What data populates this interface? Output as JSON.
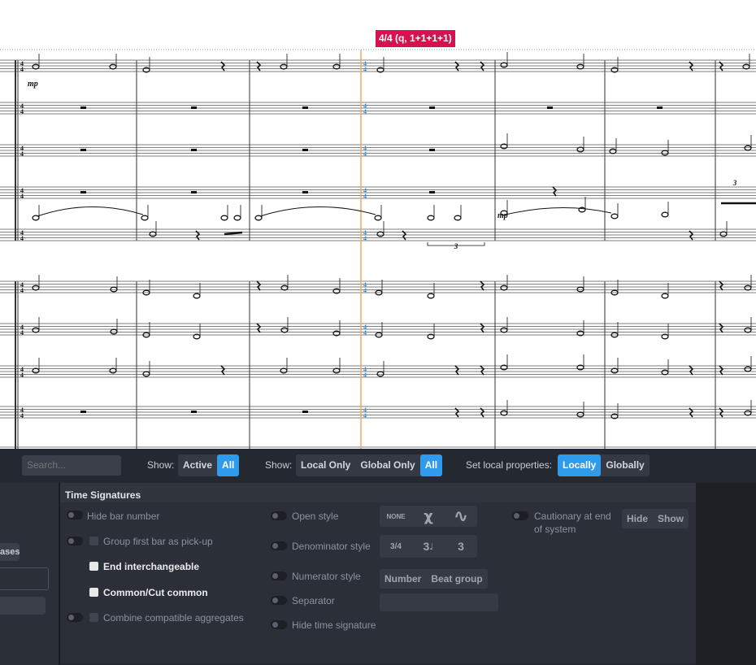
{
  "score": {
    "time_signature_tag": "4/4 (q, 1+1+1+1)",
    "dynamic_mark": "mp",
    "tuplet_number": "3"
  },
  "filter_bar": {
    "search_placeholder": "Search...",
    "show_label_1": "Show:",
    "active_label": "Active",
    "all_label_1": "All",
    "show_label_2": "Show:",
    "local_only_label": "Local Only",
    "global_only_label": "Global Only",
    "all_label_2": "All",
    "set_local_label": "Set local properties:",
    "locally_label": "Locally",
    "globally_label": "Globally"
  },
  "left_fragment": {
    "button_label": "ases"
  },
  "time_signatures": {
    "title": "Time Signatures",
    "col1": {
      "hide_bar_number": "Hide bar number",
      "group_first_bar": "Group first bar as pick-up",
      "end_interchangeable": "End interchangeable",
      "common_cut": "Common/Cut common",
      "combine_aggregates": "Combine compatible aggregates"
    },
    "col2": {
      "open_style": "Open style",
      "denominator_style": "Denominator style",
      "numerator_style": "Numerator style",
      "separator": "Separator",
      "hide_time_signature": "Hide time signature"
    },
    "open_style_options": {
      "none": "NONE",
      "x": "χ",
      "wave": "∿"
    },
    "denominator_options": {
      "fraction": "3/4",
      "note": "3",
      "plain": "3"
    },
    "numerator_options": {
      "number": "Number",
      "beat_group": "Beat group"
    },
    "col3": {
      "cautionary": "Cautionary at end of system",
      "hide": "Hide",
      "show": "Show"
    }
  },
  "colors": {
    "accent": "#2f9bec",
    "tag": "#d7114f",
    "panel_bg": "#242830",
    "card_bg": "#2b2f38",
    "selection_line": "#f2a860"
  }
}
